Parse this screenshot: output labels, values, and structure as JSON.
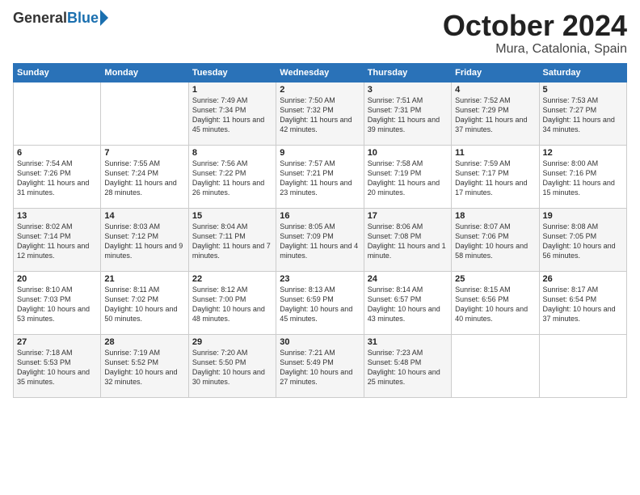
{
  "header": {
    "logo_general": "General",
    "logo_blue": "Blue",
    "month_title": "October 2024",
    "location": "Mura, Catalonia, Spain"
  },
  "days_of_week": [
    "Sunday",
    "Monday",
    "Tuesday",
    "Wednesday",
    "Thursday",
    "Friday",
    "Saturday"
  ],
  "weeks": [
    [
      {
        "day": "",
        "content": ""
      },
      {
        "day": "",
        "content": ""
      },
      {
        "day": "1",
        "content": "Sunrise: 7:49 AM\nSunset: 7:34 PM\nDaylight: 11 hours and 45 minutes."
      },
      {
        "day": "2",
        "content": "Sunrise: 7:50 AM\nSunset: 7:32 PM\nDaylight: 11 hours and 42 minutes."
      },
      {
        "day": "3",
        "content": "Sunrise: 7:51 AM\nSunset: 7:31 PM\nDaylight: 11 hours and 39 minutes."
      },
      {
        "day": "4",
        "content": "Sunrise: 7:52 AM\nSunset: 7:29 PM\nDaylight: 11 hours and 37 minutes."
      },
      {
        "day": "5",
        "content": "Sunrise: 7:53 AM\nSunset: 7:27 PM\nDaylight: 11 hours and 34 minutes."
      }
    ],
    [
      {
        "day": "6",
        "content": "Sunrise: 7:54 AM\nSunset: 7:26 PM\nDaylight: 11 hours and 31 minutes."
      },
      {
        "day": "7",
        "content": "Sunrise: 7:55 AM\nSunset: 7:24 PM\nDaylight: 11 hours and 28 minutes."
      },
      {
        "day": "8",
        "content": "Sunrise: 7:56 AM\nSunset: 7:22 PM\nDaylight: 11 hours and 26 minutes."
      },
      {
        "day": "9",
        "content": "Sunrise: 7:57 AM\nSunset: 7:21 PM\nDaylight: 11 hours and 23 minutes."
      },
      {
        "day": "10",
        "content": "Sunrise: 7:58 AM\nSunset: 7:19 PM\nDaylight: 11 hours and 20 minutes."
      },
      {
        "day": "11",
        "content": "Sunrise: 7:59 AM\nSunset: 7:17 PM\nDaylight: 11 hours and 17 minutes."
      },
      {
        "day": "12",
        "content": "Sunrise: 8:00 AM\nSunset: 7:16 PM\nDaylight: 11 hours and 15 minutes."
      }
    ],
    [
      {
        "day": "13",
        "content": "Sunrise: 8:02 AM\nSunset: 7:14 PM\nDaylight: 11 hours and 12 minutes."
      },
      {
        "day": "14",
        "content": "Sunrise: 8:03 AM\nSunset: 7:12 PM\nDaylight: 11 hours and 9 minutes."
      },
      {
        "day": "15",
        "content": "Sunrise: 8:04 AM\nSunset: 7:11 PM\nDaylight: 11 hours and 7 minutes."
      },
      {
        "day": "16",
        "content": "Sunrise: 8:05 AM\nSunset: 7:09 PM\nDaylight: 11 hours and 4 minutes."
      },
      {
        "day": "17",
        "content": "Sunrise: 8:06 AM\nSunset: 7:08 PM\nDaylight: 11 hours and 1 minute."
      },
      {
        "day": "18",
        "content": "Sunrise: 8:07 AM\nSunset: 7:06 PM\nDaylight: 10 hours and 58 minutes."
      },
      {
        "day": "19",
        "content": "Sunrise: 8:08 AM\nSunset: 7:05 PM\nDaylight: 10 hours and 56 minutes."
      }
    ],
    [
      {
        "day": "20",
        "content": "Sunrise: 8:10 AM\nSunset: 7:03 PM\nDaylight: 10 hours and 53 minutes."
      },
      {
        "day": "21",
        "content": "Sunrise: 8:11 AM\nSunset: 7:02 PM\nDaylight: 10 hours and 50 minutes."
      },
      {
        "day": "22",
        "content": "Sunrise: 8:12 AM\nSunset: 7:00 PM\nDaylight: 10 hours and 48 minutes."
      },
      {
        "day": "23",
        "content": "Sunrise: 8:13 AM\nSunset: 6:59 PM\nDaylight: 10 hours and 45 minutes."
      },
      {
        "day": "24",
        "content": "Sunrise: 8:14 AM\nSunset: 6:57 PM\nDaylight: 10 hours and 43 minutes."
      },
      {
        "day": "25",
        "content": "Sunrise: 8:15 AM\nSunset: 6:56 PM\nDaylight: 10 hours and 40 minutes."
      },
      {
        "day": "26",
        "content": "Sunrise: 8:17 AM\nSunset: 6:54 PM\nDaylight: 10 hours and 37 minutes."
      }
    ],
    [
      {
        "day": "27",
        "content": "Sunrise: 7:18 AM\nSunset: 5:53 PM\nDaylight: 10 hours and 35 minutes."
      },
      {
        "day": "28",
        "content": "Sunrise: 7:19 AM\nSunset: 5:52 PM\nDaylight: 10 hours and 32 minutes."
      },
      {
        "day": "29",
        "content": "Sunrise: 7:20 AM\nSunset: 5:50 PM\nDaylight: 10 hours and 30 minutes."
      },
      {
        "day": "30",
        "content": "Sunrise: 7:21 AM\nSunset: 5:49 PM\nDaylight: 10 hours and 27 minutes."
      },
      {
        "day": "31",
        "content": "Sunrise: 7:23 AM\nSunset: 5:48 PM\nDaylight: 10 hours and 25 minutes."
      },
      {
        "day": "",
        "content": ""
      },
      {
        "day": "",
        "content": ""
      }
    ]
  ]
}
